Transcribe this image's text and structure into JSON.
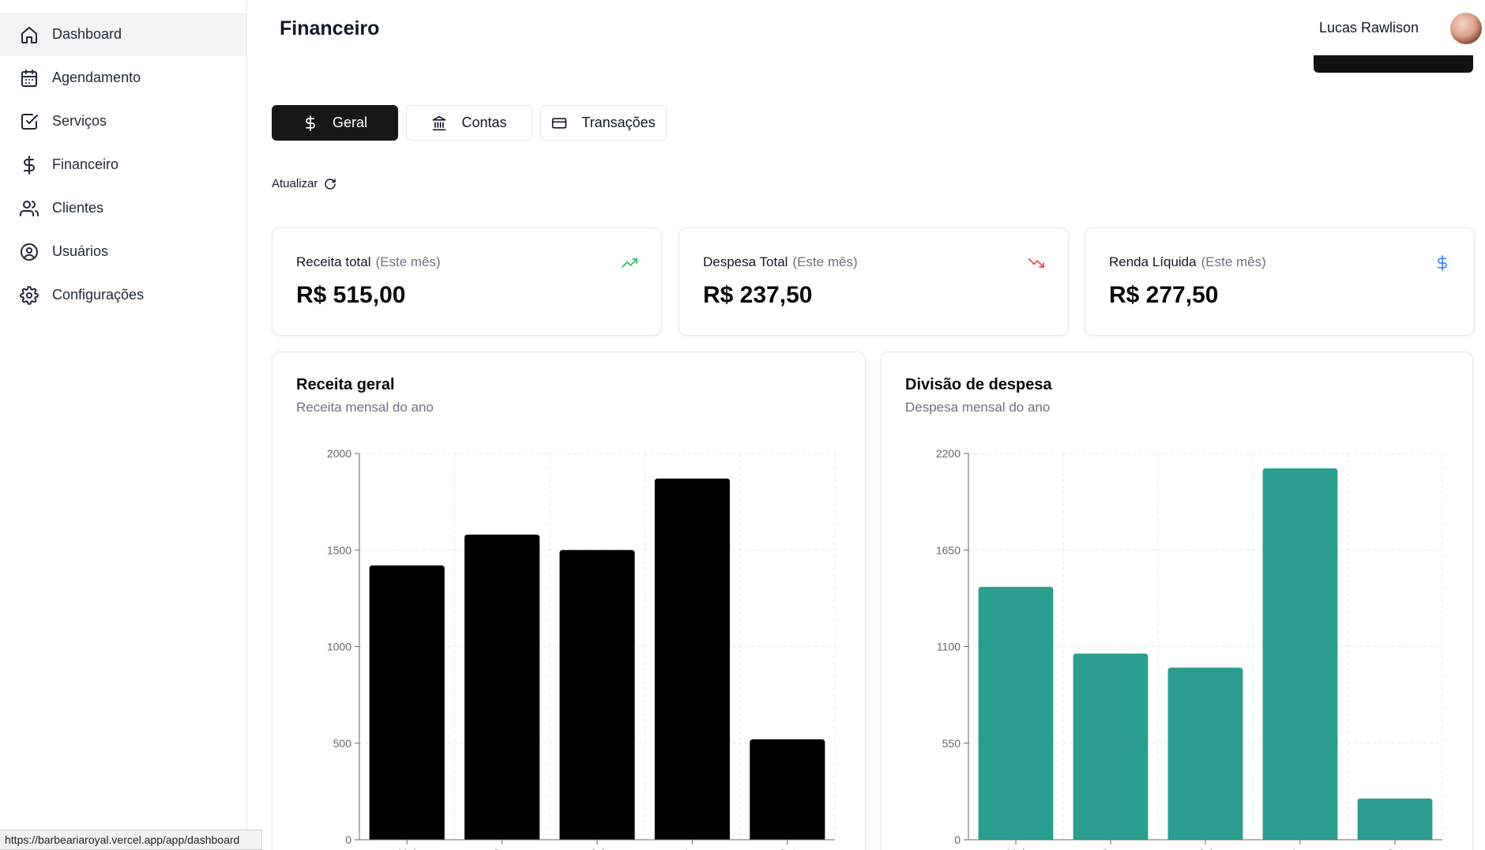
{
  "sidebar": {
    "items": [
      {
        "label": "Dashboard",
        "icon": "home-icon",
        "active": true
      },
      {
        "label": "Agendamento",
        "icon": "calendar-icon",
        "active": false
      },
      {
        "label": "Serviços",
        "icon": "check-square-icon",
        "active": false
      },
      {
        "label": "Financeiro",
        "icon": "dollar-icon",
        "active": false
      },
      {
        "label": "Clientes",
        "icon": "users-icon",
        "active": false
      },
      {
        "label": "Usuários",
        "icon": "user-circle-icon",
        "active": false
      },
      {
        "label": "Configurações",
        "icon": "gear-icon",
        "active": false
      }
    ]
  },
  "header": {
    "title": "Financeiro",
    "user_name": "Lucas Rawlison"
  },
  "tabs": [
    {
      "label": "Geral",
      "icon": "dollar-icon",
      "active": true
    },
    {
      "label": "Contas",
      "icon": "bank-icon",
      "active": false
    },
    {
      "label": "Transações",
      "icon": "credit-card-icon",
      "active": false
    }
  ],
  "refresh_label": "Atualizar",
  "stats": [
    {
      "label": "Receita total",
      "period": "(Este mês)",
      "value": "R$ 515,00",
      "icon": "trending-up-icon",
      "color": "#22c55e"
    },
    {
      "label": "Despesa Total",
      "period": "(Este mês)",
      "value": "R$ 237,50",
      "icon": "trending-down-icon",
      "color": "#ef4444"
    },
    {
      "label": "Renda Líquida",
      "period": "(Este mês)",
      "value": "R$ 277,50",
      "icon": "dollar-icon",
      "color": "#3b82f6"
    }
  ],
  "charts": {
    "revenue": {
      "title": "Receita geral",
      "subtitle": "Receita mensal do ano"
    },
    "expense": {
      "title": "Divisão de despesa",
      "subtitle": "Despesa mensal do ano"
    }
  },
  "chart_data": [
    {
      "type": "bar",
      "title": "Receita geral",
      "subtitle": "Receita mensal do ano",
      "categories": [
        "Mai",
        "Jun",
        "Jul",
        "Ago",
        "Set"
      ],
      "values": [
        1420,
        1580,
        1500,
        1870,
        520
      ],
      "yticks": [
        0,
        500,
        1000,
        1500,
        2000
      ],
      "ylim": [
        0,
        2000
      ],
      "color": "#000000",
      "grid": true
    },
    {
      "type": "bar",
      "title": "Divisão de despesa",
      "subtitle": "Despesa mensal do ano",
      "categories": [
        "Mai",
        "Jun",
        "Jul",
        "Ago",
        "Set"
      ],
      "values": [
        1440,
        1060,
        980,
        2115,
        235
      ],
      "yticks": [
        0,
        550,
        1100,
        1650,
        2200
      ],
      "ylim": [
        0,
        2200
      ],
      "color": "#2a9d8f",
      "grid": true
    }
  ],
  "status_url": "https://barbeariaroyal.vercel.app/app/dashboard"
}
